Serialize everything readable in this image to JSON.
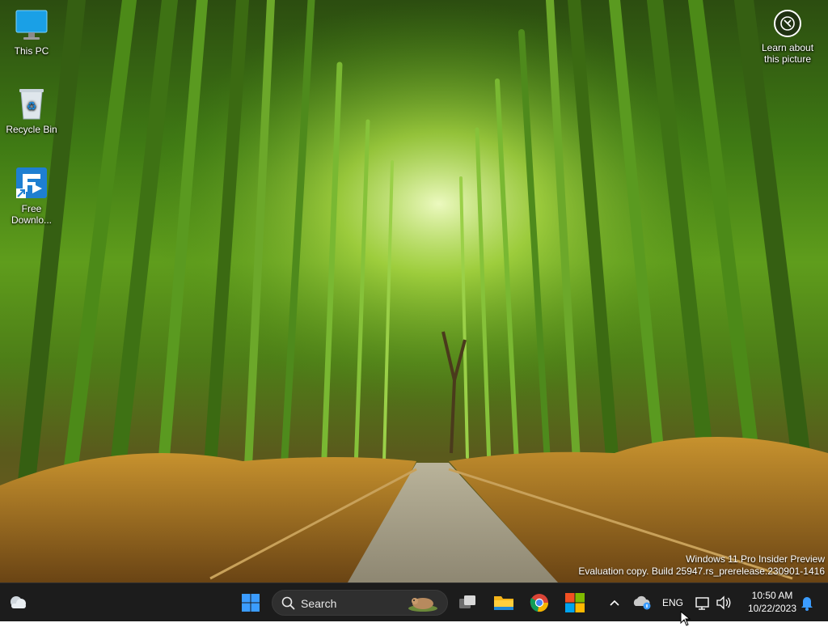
{
  "desktop": {
    "icons": [
      {
        "label": "This PC",
        "icon": "monitor-icon"
      },
      {
        "label": "Recycle Bin",
        "icon": "recycle-bin-icon"
      },
      {
        "label": "Free Downlo...",
        "icon": "free-download-manager-icon"
      }
    ],
    "spotlight": {
      "label_line1": "Learn about",
      "label_line2": "this picture",
      "icon": "camera-circle-icon"
    },
    "watermark": {
      "line1": "Windows 11 Pro Insider Preview",
      "line2": "Evaluation copy. Build 25947.rs_prerelease.230901-1416"
    }
  },
  "taskbar": {
    "widgets_icon": "weather-cloud-icon",
    "start_icon": "windows-logo-icon",
    "search": {
      "placeholder": "Search"
    },
    "pinned": [
      {
        "name": "task-view",
        "icon": "task-view-icon"
      },
      {
        "name": "file-explorer",
        "icon": "folder-icon"
      },
      {
        "name": "chrome",
        "icon": "chrome-icon"
      },
      {
        "name": "microsoft-store",
        "icon": "store-icon"
      }
    ],
    "tray": {
      "language": "ENG",
      "time": "10:50 AM",
      "date": "10/22/2023"
    }
  },
  "colors": {
    "taskbar_bg": "#1c1c1c",
    "accent_blue": "#3b9cff"
  }
}
